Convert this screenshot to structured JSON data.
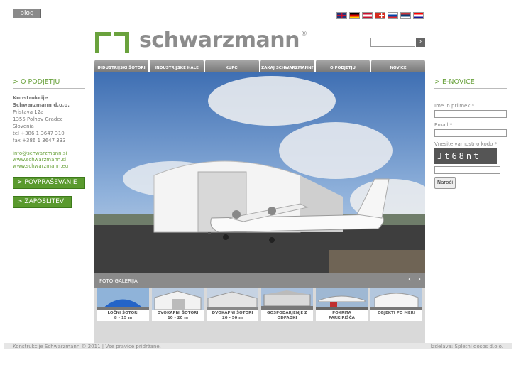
{
  "header": {
    "blog_label": "blog",
    "flags": [
      "uk-flag-icon",
      "de-flag-icon",
      "at-flag-icon",
      "ch-flag-icon",
      "si-flag-icon",
      "rs-flag-icon",
      "hr-flag-icon"
    ],
    "logo_text": "schwarzmann",
    "logo_reg": "®",
    "search_go": "›"
  },
  "nav": {
    "items": [
      "INDUSTRIJSKI ŠOTORI",
      "INDUSTRIJSKE HALE",
      "KUPCI",
      "ZAKAJ SCHWARZMANN?",
      "O PODJETJU",
      "NOVICE"
    ]
  },
  "left": {
    "title": "> O PODJETJU",
    "company_line1": "Konstrukcije",
    "company_line2": "Schwarzmann d.o.o.",
    "street": "Pristava 12a",
    "city": "1355 Polhov Gradec",
    "country": "Slovenia",
    "tel": "tel +386 1 3647 310",
    "fax": "fax +386 1 3647 333",
    "email": "info@schwarzmann.si",
    "web1": "www.schwarzmann.si",
    "web2": "www.schwarzmann.eu",
    "btn_inquiry": "> POVPRAŠEVANJE",
    "btn_jobs": "> ZAPOSLITEV"
  },
  "gallery": {
    "title": "FOTO GALERIJA",
    "prev": "‹",
    "next": "›",
    "thumbs": [
      {
        "line1": "LOČNI ŠOTORI",
        "line2": "8 - 15 m"
      },
      {
        "line1": "DVOKAPNI ŠOTORI",
        "line2": "10 - 20 m"
      },
      {
        "line1": "DVOKAPNI ŠOTORI",
        "line2": "20 - 50 m"
      },
      {
        "line1": "GOSPODARJENJE Z",
        "line2": "ODPADKI"
      },
      {
        "line1": "POKRITA",
        "line2": "PARKIRIŠČA"
      },
      {
        "line1": "OBJEKTI PO MERI",
        "line2": ""
      }
    ]
  },
  "right": {
    "title": "> E-NOVICE",
    "name_label": "Ime in priimek *",
    "email_label": "Email *",
    "code_label": "Vnesite varnostno kodo *",
    "captcha_text": "Jt68nt",
    "submit": "Naroči"
  },
  "footer": {
    "copyright": "Konstrukcije Schwarzmann © 2011 | Vse pravice pridržane.",
    "made_by_label": "Izdelava:",
    "made_by_link": "Spletni dosos d.o.o."
  }
}
